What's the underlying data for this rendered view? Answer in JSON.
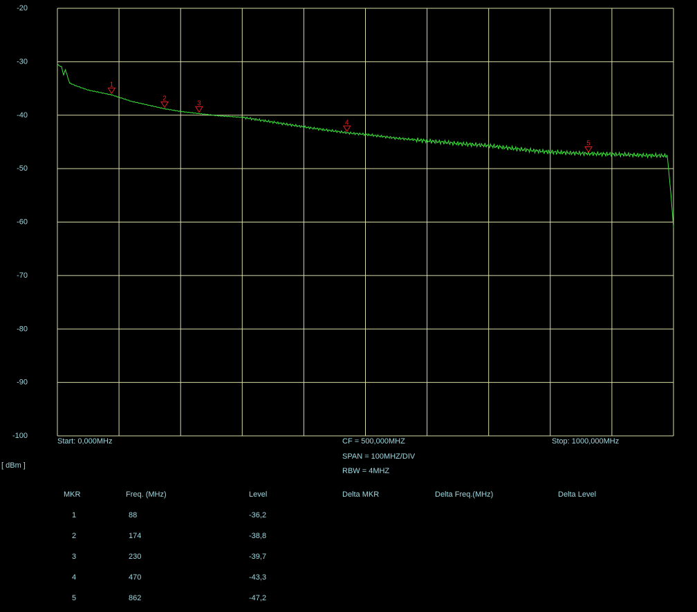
{
  "colors": {
    "background": "#000000",
    "grid": "#d8dca8",
    "trace": "#39e639",
    "marker": "#e02020",
    "text": "#9ed7df"
  },
  "chart_data": {
    "type": "line",
    "unit_label": "[ dBm ]",
    "x_range_mhz": [
      0,
      1000
    ],
    "ylim": [
      -100,
      -20
    ],
    "y_ticks": [
      "-20",
      "-30",
      "-40",
      "-50",
      "-60",
      "-70",
      "-80",
      "-90",
      "-100"
    ],
    "grid": true,
    "series": [
      {
        "x": [
          0,
          7,
          10,
          13,
          17,
          20,
          30,
          50,
          88,
          120,
          174,
          200,
          230,
          260,
          300,
          350,
          400,
          470,
          500,
          550,
          600,
          650,
          700,
          760,
          800,
          862,
          900,
          950,
          990,
          996,
          1000
        ],
        "y": [
          -30.5,
          -31,
          -32.5,
          -31.5,
          -33,
          -34,
          -34.5,
          -35.3,
          -36.2,
          -37.4,
          -38.8,
          -39.3,
          -39.7,
          -40.1,
          -40.4,
          -41.3,
          -42.2,
          -43.3,
          -43.6,
          -44.3,
          -44.8,
          -45.3,
          -45.7,
          -46.5,
          -46.9,
          -47.2,
          -47.3,
          -47.5,
          -47.6,
          -55,
          -61
        ]
      }
    ],
    "markers": [
      {
        "label": "1",
        "freq": 88,
        "level": -36.2
      },
      {
        "label": "2",
        "freq": 174,
        "level": -38.8
      },
      {
        "label": "3",
        "freq": 230,
        "level": -39.7
      },
      {
        "label": "4",
        "freq": 470,
        "level": -43.3
      },
      {
        "label": "5",
        "freq": 862,
        "level": -47.2
      }
    ]
  },
  "info": {
    "start": "Start:  0,000MHz",
    "cf": "CF = 500,000MHZ",
    "span": "SPAN = 100MHZ/DIV",
    "rbw": "RBW = 4MHZ",
    "stop": "Stop:  1000,000MHz"
  },
  "table": {
    "headers": {
      "mkr": "MKR",
      "freq": "Freq. (MHz)",
      "level": "Level",
      "delta_mkr": "Delta MKR",
      "delta_freq": "Delta Freq.(MHz)",
      "delta_level": "Delta Level"
    },
    "rows": [
      {
        "mkr": "1",
        "freq": "88",
        "level": "-36,2"
      },
      {
        "mkr": "2",
        "freq": "174",
        "level": "-38,8"
      },
      {
        "mkr": "3",
        "freq": "230",
        "level": "-39,7"
      },
      {
        "mkr": "4",
        "freq": "470",
        "level": "-43,3"
      },
      {
        "mkr": "5",
        "freq": "862",
        "level": "-47,2"
      }
    ]
  }
}
